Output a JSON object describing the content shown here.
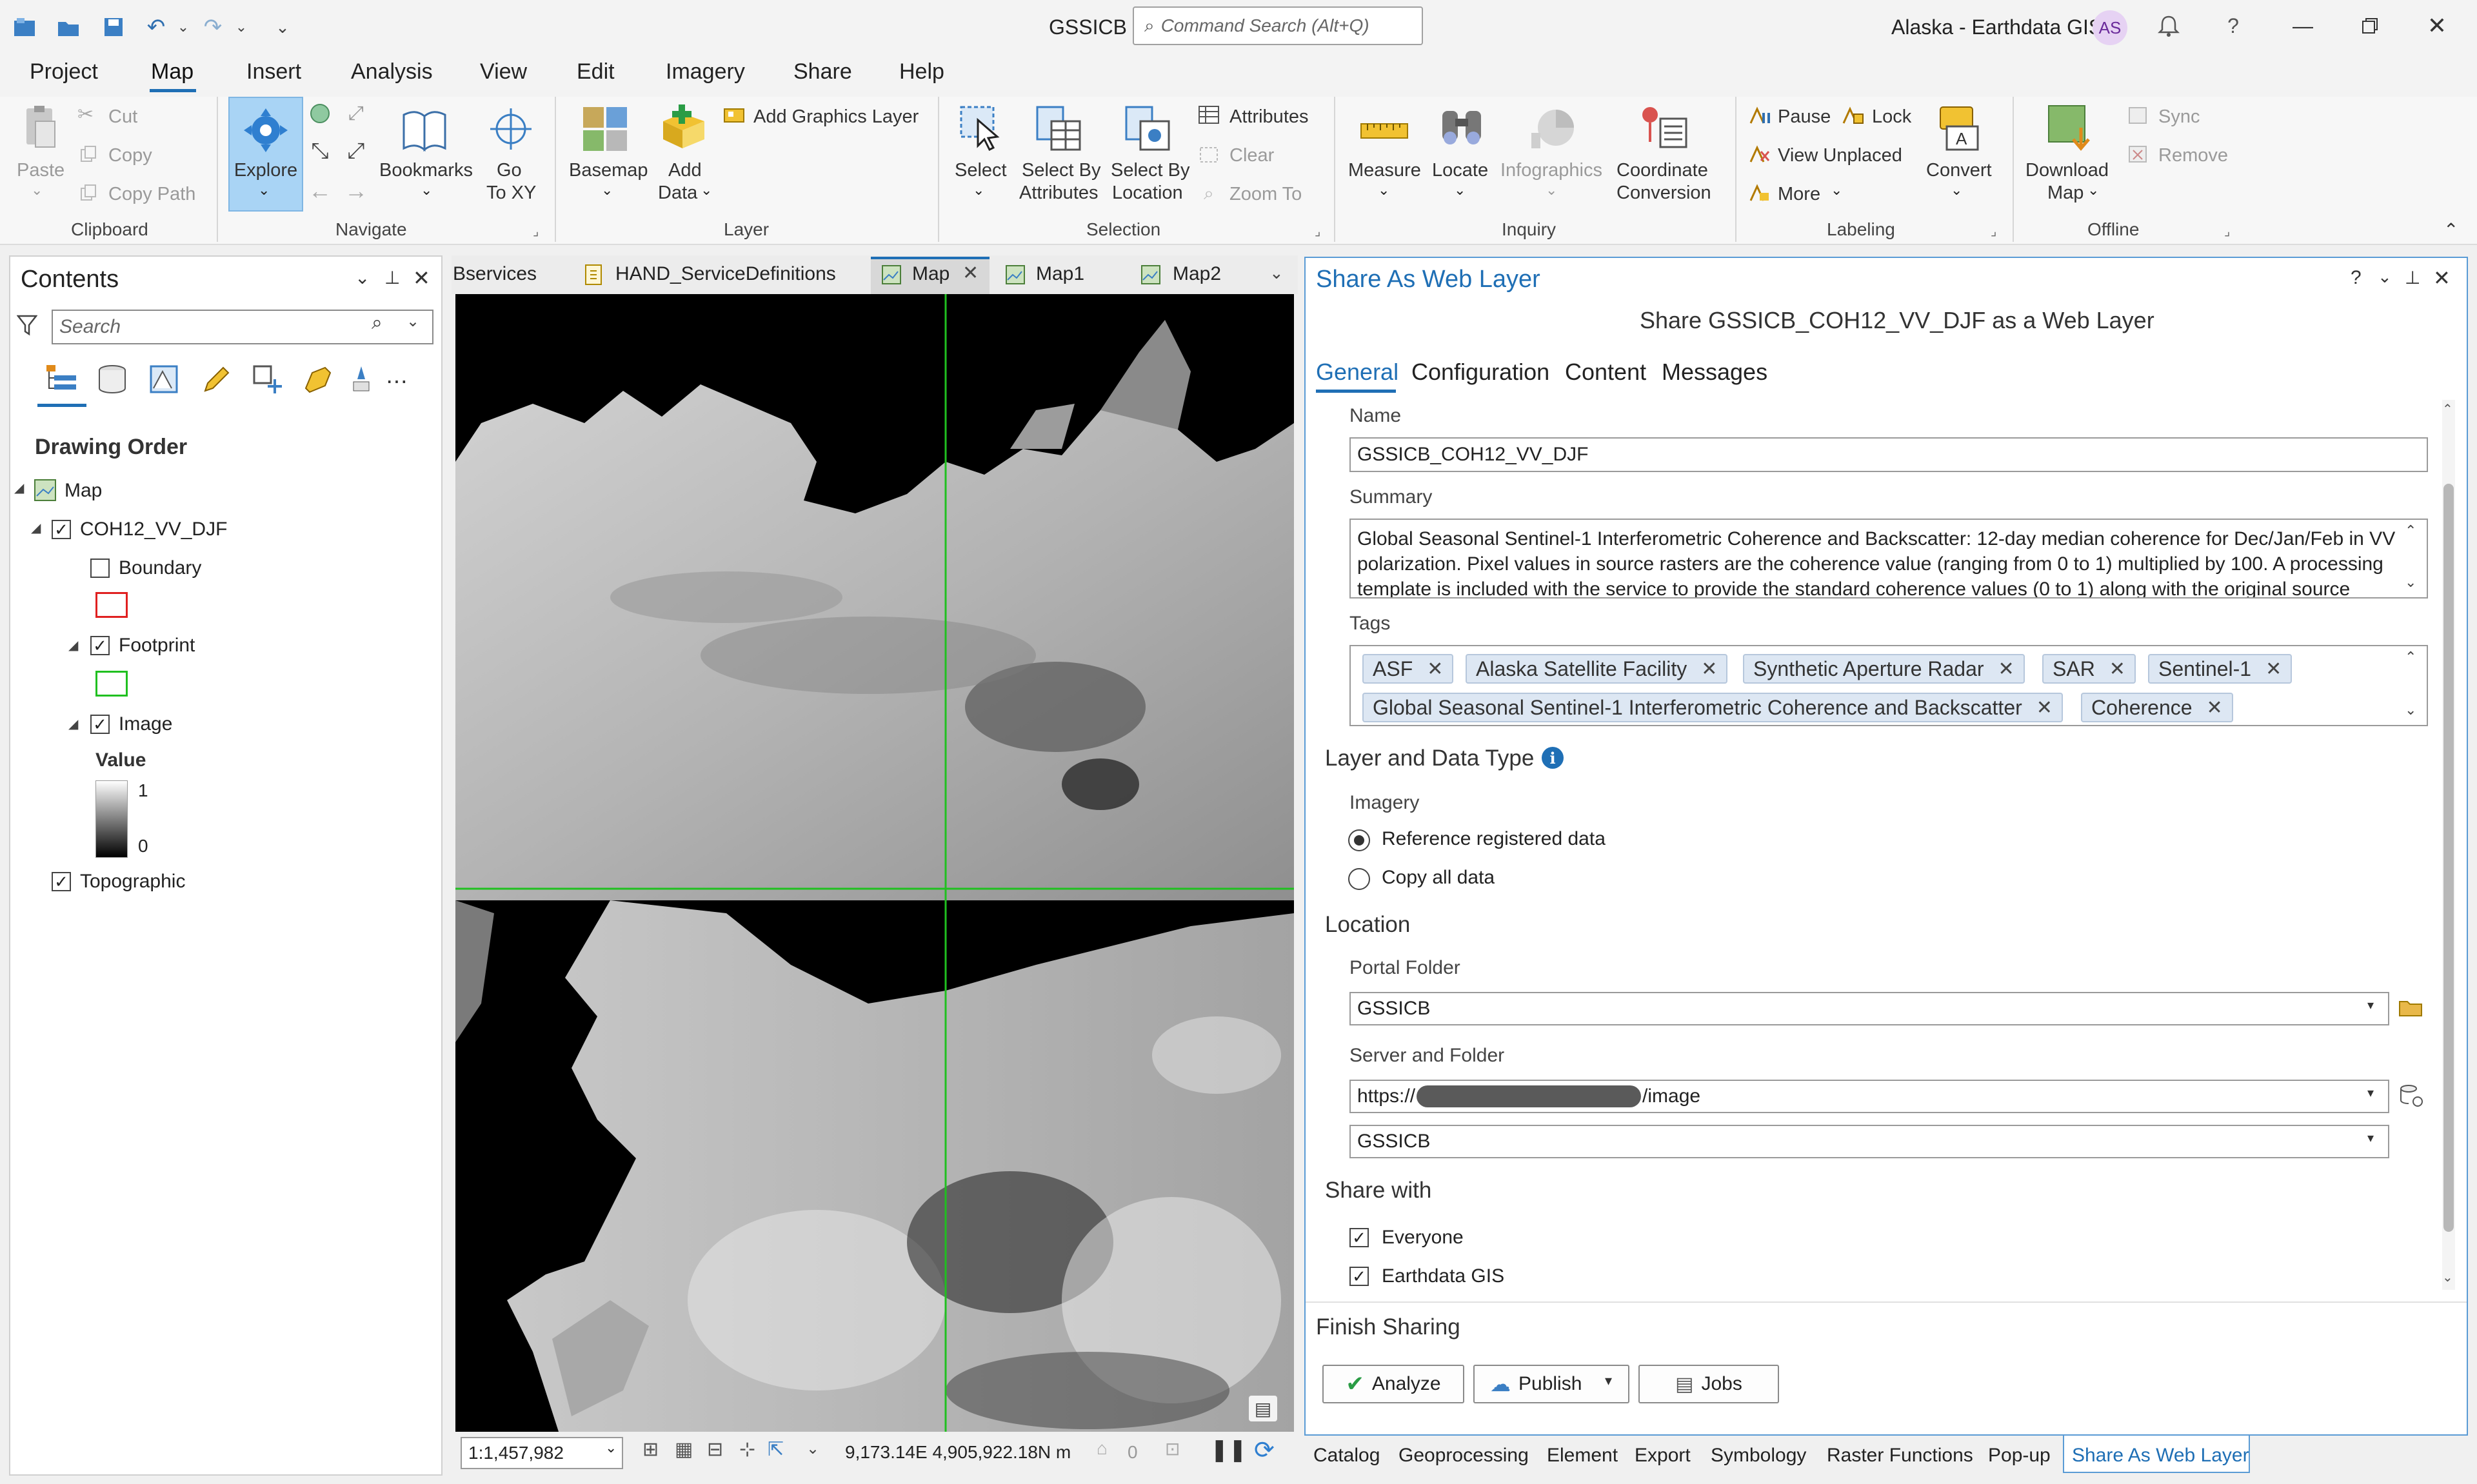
{
  "title_bar": {
    "app_title": "GSSICB",
    "command_search_placeholder": "Command Search (Alt+Q)",
    "portal": "Alaska - Earthdata GIS",
    "avatar": "AS",
    "help": "?"
  },
  "ribbon_tabs": [
    "Project",
    "Map",
    "Insert",
    "Analysis",
    "View",
    "Edit",
    "Imagery",
    "Share",
    "Help"
  ],
  "active_ribbon_tab": "Map",
  "ribbon": {
    "clipboard": {
      "paste": "Paste",
      "cut": "Cut",
      "copy": "Copy",
      "copy_path": "Copy Path",
      "group": "Clipboard"
    },
    "navigate": {
      "explore": "Explore",
      "bookmarks": "Bookmarks",
      "go_to": "Go",
      "go_to2": "To XY",
      "group": "Navigate"
    },
    "layer": {
      "basemap": "Basemap",
      "add": "Add",
      "add2": "Data",
      "add_graphics": "Add Graphics Layer",
      "group": "Layer"
    },
    "selection": {
      "select": "Select",
      "by_attr": "Select By",
      "by_attr2": "Attributes",
      "by_loc": "Select By",
      "by_loc2": "Location",
      "attributes": "Attributes",
      "clear": "Clear",
      "zoom_to": "Zoom To",
      "group": "Selection"
    },
    "inquiry": {
      "measure": "Measure",
      "locate": "Locate",
      "infographics": "Infographics",
      "coord": "Coordinate",
      "coord2": "Conversion",
      "group": "Inquiry"
    },
    "labeling": {
      "pause": "Pause",
      "lock": "Lock",
      "view_unplaced": "View Unplaced",
      "more": "More",
      "convert": "Convert",
      "group": "Labeling"
    },
    "offline": {
      "download": "Download",
      "download2": "Map",
      "sync": "Sync",
      "remove": "Remove",
      "group": "Offline"
    }
  },
  "contents": {
    "title": "Contents",
    "search_placeholder": "Search",
    "drawing_order": "Drawing Order",
    "map": "Map",
    "layer": "COH12_VV_DJF",
    "boundary": "Boundary",
    "footprint": "Footprint",
    "image": "Image",
    "value": "Value",
    "value_high": "1",
    "value_low": "0",
    "topographic": "Topographic",
    "boundary_color": "#e02020",
    "footprint_color": "#20c020"
  },
  "map_tabs": [
    "Bservices",
    "HAND_ServiceDefinitions",
    "Map",
    "Map1",
    "Map2"
  ],
  "active_map_tab": "Map",
  "status": {
    "scale": "1:1,457,982",
    "coords": "9,173.14E 4,905,922.18N m",
    "selected_count": "0"
  },
  "share": {
    "pane_title": "Share As Web Layer",
    "heading": "Share GSSICB_COH12_VV_DJF as a Web Layer",
    "tabs": [
      "General",
      "Configuration",
      "Content",
      "Messages"
    ],
    "active_tab": "General",
    "name_label": "Name",
    "name_value": "GSSICB_COH12_VV_DJF",
    "summary_label": "Summary",
    "summary_lines": [
      "Global Seasonal Sentinel-1 Interferometric Coherence and Backscatter: 12-day median coherence for Dec/Jan/Feb in VV",
      "polarization. Pixel values in source rasters are the coherence value (ranging from 0 to 1) multiplied by 100. A processing",
      "template is included with the service to provide the standard coherence values (0 to 1) along with the original source"
    ],
    "tags_label": "Tags",
    "tags": [
      "ASF",
      "Alaska Satellite Facility",
      "Synthetic Aperture Radar",
      "SAR",
      "Sentinel-1",
      "Global Seasonal Sentinel-1 Interferometric Coherence and Backscatter",
      "Coherence"
    ],
    "layer_type_heading": "Layer and Data Type",
    "imagery_label": "Imagery",
    "option_reference": "Reference registered data",
    "option_copy": "Copy all data",
    "location_heading": "Location",
    "portal_folder_label": "Portal Folder",
    "portal_folder_value": "GSSICB",
    "server_folder_label": "Server and Folder",
    "server_url_prefix": "https://",
    "server_url_suffix": "/image",
    "server_folder_value": "GSSICB",
    "share_with_heading": "Share with",
    "everyone": "Everyone",
    "earthdata": "Earthdata GIS",
    "finish_heading": "Finish Sharing",
    "analyze": "Analyze",
    "publish": "Publish",
    "jobs": "Jobs"
  },
  "bottom_tabs": [
    "Catalog",
    "Geoprocessing",
    "Element",
    "Export",
    "Symbology",
    "Raster Functions",
    "Pop-up",
    "Share As Web Layer"
  ],
  "active_bottom_tab": "Share As Web Layer",
  "colors": {
    "accent": "#1f6fb5",
    "active_tab_bg": "#ffffff",
    "explore_bg": "#a9d4f5",
    "ribbon_bg": "#f7f7f7"
  }
}
